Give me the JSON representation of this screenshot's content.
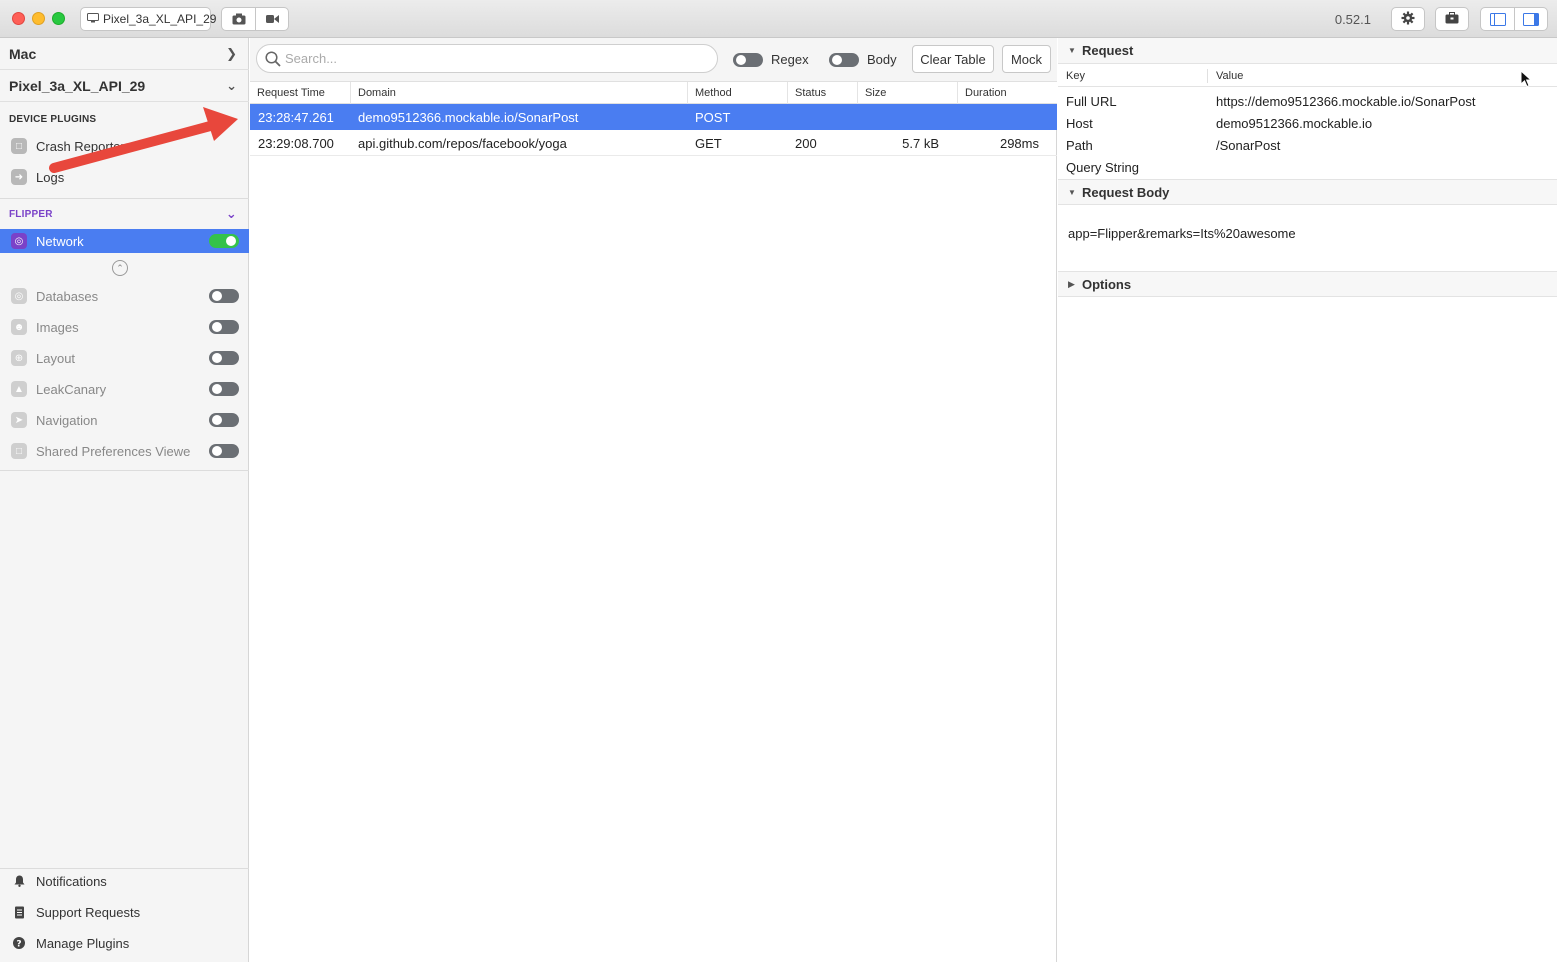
{
  "titlebar": {
    "device_selector": "Pixel_3a_XL_API_29",
    "version": "0.52.1"
  },
  "sidebar": {
    "app_mac": "Mac",
    "app_device": "Pixel_3a_XL_API_29",
    "device_plugins_title": "DEVICE PLUGINS",
    "device_plugins": [
      {
        "label": "Crash Reporter",
        "icon": "crash-reporter-icon"
      },
      {
        "label": "Logs",
        "icon": "logs-icon"
      }
    ],
    "flipper_title": "FLIPPER",
    "active_plugin": {
      "label": "Network",
      "icon": "globe-icon",
      "enabled": true
    },
    "disabled_plugins": [
      {
        "label": "Databases",
        "icon": "database-icon",
        "enabled": false
      },
      {
        "label": "Images",
        "icon": "images-icon",
        "enabled": false
      },
      {
        "label": "Layout",
        "icon": "layout-icon",
        "enabled": false
      },
      {
        "label": "LeakCanary",
        "icon": "leakcanary-icon",
        "enabled": false
      },
      {
        "label": "Navigation",
        "icon": "navigation-icon",
        "enabled": false
      },
      {
        "label": "Shared Preferences Viewe",
        "icon": "shared-preferences-icon",
        "enabled": false
      }
    ],
    "footer": [
      {
        "label": "Notifications",
        "icon": "bell-icon"
      },
      {
        "label": "Support Requests",
        "icon": "support-icon"
      },
      {
        "label": "Manage Plugins",
        "icon": "help-icon"
      }
    ]
  },
  "network": {
    "search_placeholder": "Search...",
    "regex_label": "Regex",
    "body_label": "Body",
    "clear_table_label": "Clear Table",
    "mock_label": "Mock",
    "columns": [
      "Request Time",
      "Domain",
      "Method",
      "Status",
      "Size",
      "Duration"
    ],
    "rows": [
      {
        "time": "23:28:47.261",
        "domain": "demo9512366.mockable.io/SonarPost",
        "method": "POST",
        "status": "",
        "size": "",
        "duration": "",
        "selected": true
      },
      {
        "time": "23:29:08.700",
        "domain": "api.github.com/repos/facebook/yoga",
        "method": "GET",
        "status": "200",
        "size": "5.7 kB",
        "duration": "298ms",
        "selected": false
      }
    ]
  },
  "details": {
    "request_title": "Request",
    "key_header": "Key",
    "value_header": "Value",
    "fields": [
      {
        "key": "Full URL",
        "value": "https://demo9512366.mockable.io/SonarPost"
      },
      {
        "key": "Host",
        "value": "demo9512366.mockable.io"
      },
      {
        "key": "Path",
        "value": "/SonarPost"
      },
      {
        "key": "Query String",
        "value": ""
      }
    ],
    "request_body_title": "Request Body",
    "request_body": "app=Flipper&remarks=Its%20awesome",
    "options_title": "Options"
  },
  "colors": {
    "selection": "#4a7df1",
    "flipper_accent": "#7a42c8",
    "toggle_on": "#34c24a",
    "annotation_arrow": "#e8473c"
  }
}
